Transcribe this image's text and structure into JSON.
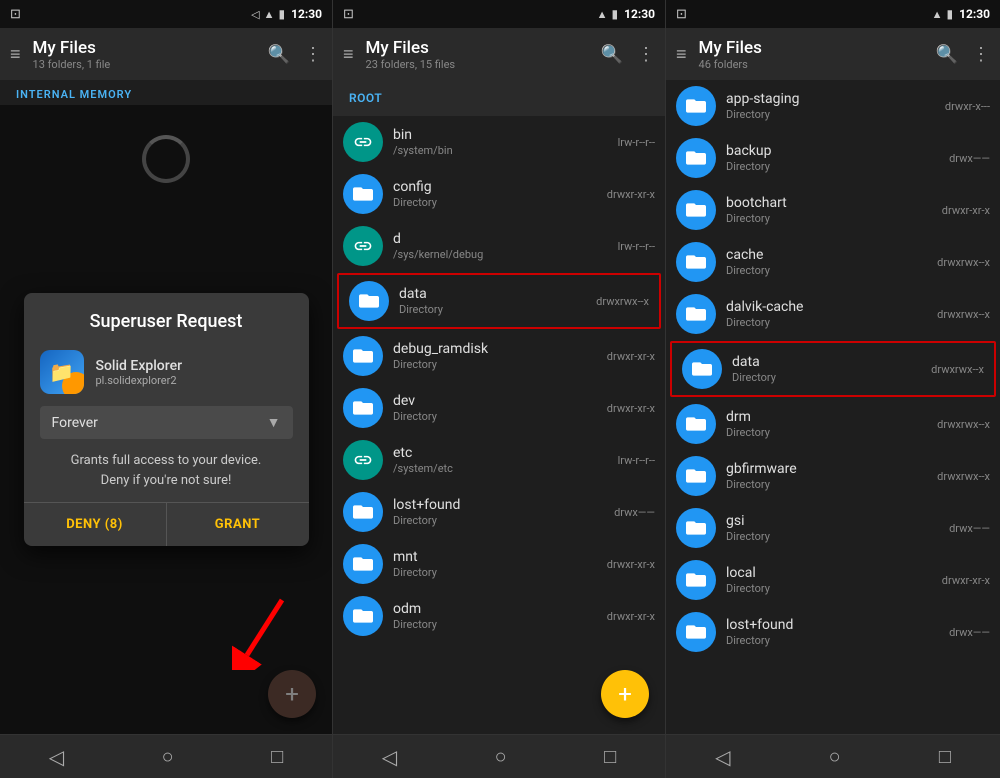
{
  "panels": [
    {
      "id": "panel1",
      "statusBar": {
        "time": "12:30",
        "leftIcon": "cast-icon"
      },
      "topBar": {
        "title": "My Files",
        "subtitle": "13 folders, 1 file",
        "menuIcon": "≡",
        "searchIcon": "🔍",
        "moreIcon": "⋮"
      },
      "sectionLabel": "INTERNAL MEMORY",
      "dialog": {
        "title": "Superuser Request",
        "appName": "Solid Explorer",
        "appPackage": "pl.solidexplorer2",
        "dropdownLabel": "Forever",
        "warning1": "Grants full access to your device.",
        "warning2": "Deny if you're not sure!",
        "denyLabel": "DENY (8)",
        "grantLabel": "GRANT"
      }
    },
    {
      "id": "panel2",
      "statusBar": {
        "time": "12:30"
      },
      "topBar": {
        "title": "My Files",
        "subtitle": "23 folders, 15 files",
        "menuIcon": "≡",
        "searchIcon": "🔍",
        "moreIcon": "⋮"
      },
      "breadcrumb": "ROOT",
      "files": [
        {
          "name": "bin",
          "path": "/system/bin",
          "type": "",
          "perms": "lrw-r--r--",
          "symlink": true,
          "highlighted": false
        },
        {
          "name": "config",
          "path": "",
          "type": "Directory",
          "perms": "drwxr-xr-x",
          "symlink": false,
          "highlighted": false
        },
        {
          "name": "d",
          "path": "/sys/kernel/debug",
          "type": "",
          "perms": "lrw-r--r--",
          "symlink": true,
          "highlighted": false
        },
        {
          "name": "data",
          "path": "",
          "type": "Directory",
          "perms": "drwxrwx--x",
          "symlink": false,
          "highlighted": true
        },
        {
          "name": "debug_ramdisk",
          "path": "",
          "type": "Directory",
          "perms": "drwxr-xr-x",
          "symlink": false,
          "highlighted": false
        },
        {
          "name": "dev",
          "path": "",
          "type": "Directory",
          "perms": "drwxr-xr-x",
          "symlink": false,
          "highlighted": false
        },
        {
          "name": "etc",
          "path": "/system/etc",
          "type": "",
          "perms": "lrw-r--r--",
          "symlink": true,
          "highlighted": false
        },
        {
          "name": "lost+found",
          "path": "",
          "type": "Directory",
          "perms": "drwx——",
          "symlink": false,
          "highlighted": false
        },
        {
          "name": "mnt",
          "path": "",
          "type": "Directory",
          "perms": "drwxr-xr-x",
          "symlink": false,
          "highlighted": false
        },
        {
          "name": "odm",
          "path": "",
          "type": "Directory",
          "perms": "drwxr-xr-x",
          "symlink": false,
          "highlighted": false
        }
      ]
    },
    {
      "id": "panel3",
      "statusBar": {
        "time": "12:30"
      },
      "topBar": {
        "title": "My Files",
        "subtitle": "46 folders",
        "menuIcon": "≡",
        "searchIcon": "🔍",
        "moreIcon": "⋮"
      },
      "files": [
        {
          "name": "app-staging",
          "type": "Directory",
          "perms": "drwxr-x---",
          "highlighted": false
        },
        {
          "name": "backup",
          "type": "Directory",
          "perms": "drwx——",
          "highlighted": false,
          "badge": "backup Directory"
        },
        {
          "name": "bootchart",
          "type": "Directory",
          "perms": "drwxr-xr-x",
          "highlighted": false
        },
        {
          "name": "cache",
          "type": "Directory",
          "perms": "drwxrwx--x",
          "highlighted": false
        },
        {
          "name": "dalvik-cache",
          "type": "Directory",
          "perms": "drwxrwx--x",
          "highlighted": false
        },
        {
          "name": "data",
          "type": "Directory",
          "perms": "drwxrwx--x",
          "highlighted": true
        },
        {
          "name": "drm",
          "type": "Directory",
          "perms": "drwxrwx--x",
          "highlighted": false
        },
        {
          "name": "gbfirmware",
          "type": "Directory",
          "perms": "drwxrwx--x",
          "highlighted": false
        },
        {
          "name": "gsi",
          "type": "Directory",
          "perms": "drwx——",
          "highlighted": false
        },
        {
          "name": "local",
          "type": "Directory",
          "perms": "drwxr-xr-x",
          "highlighted": false,
          "badge": "local Directory"
        },
        {
          "name": "lost+found",
          "type": "Directory",
          "perms": "drwx——",
          "highlighted": false
        }
      ]
    }
  ]
}
